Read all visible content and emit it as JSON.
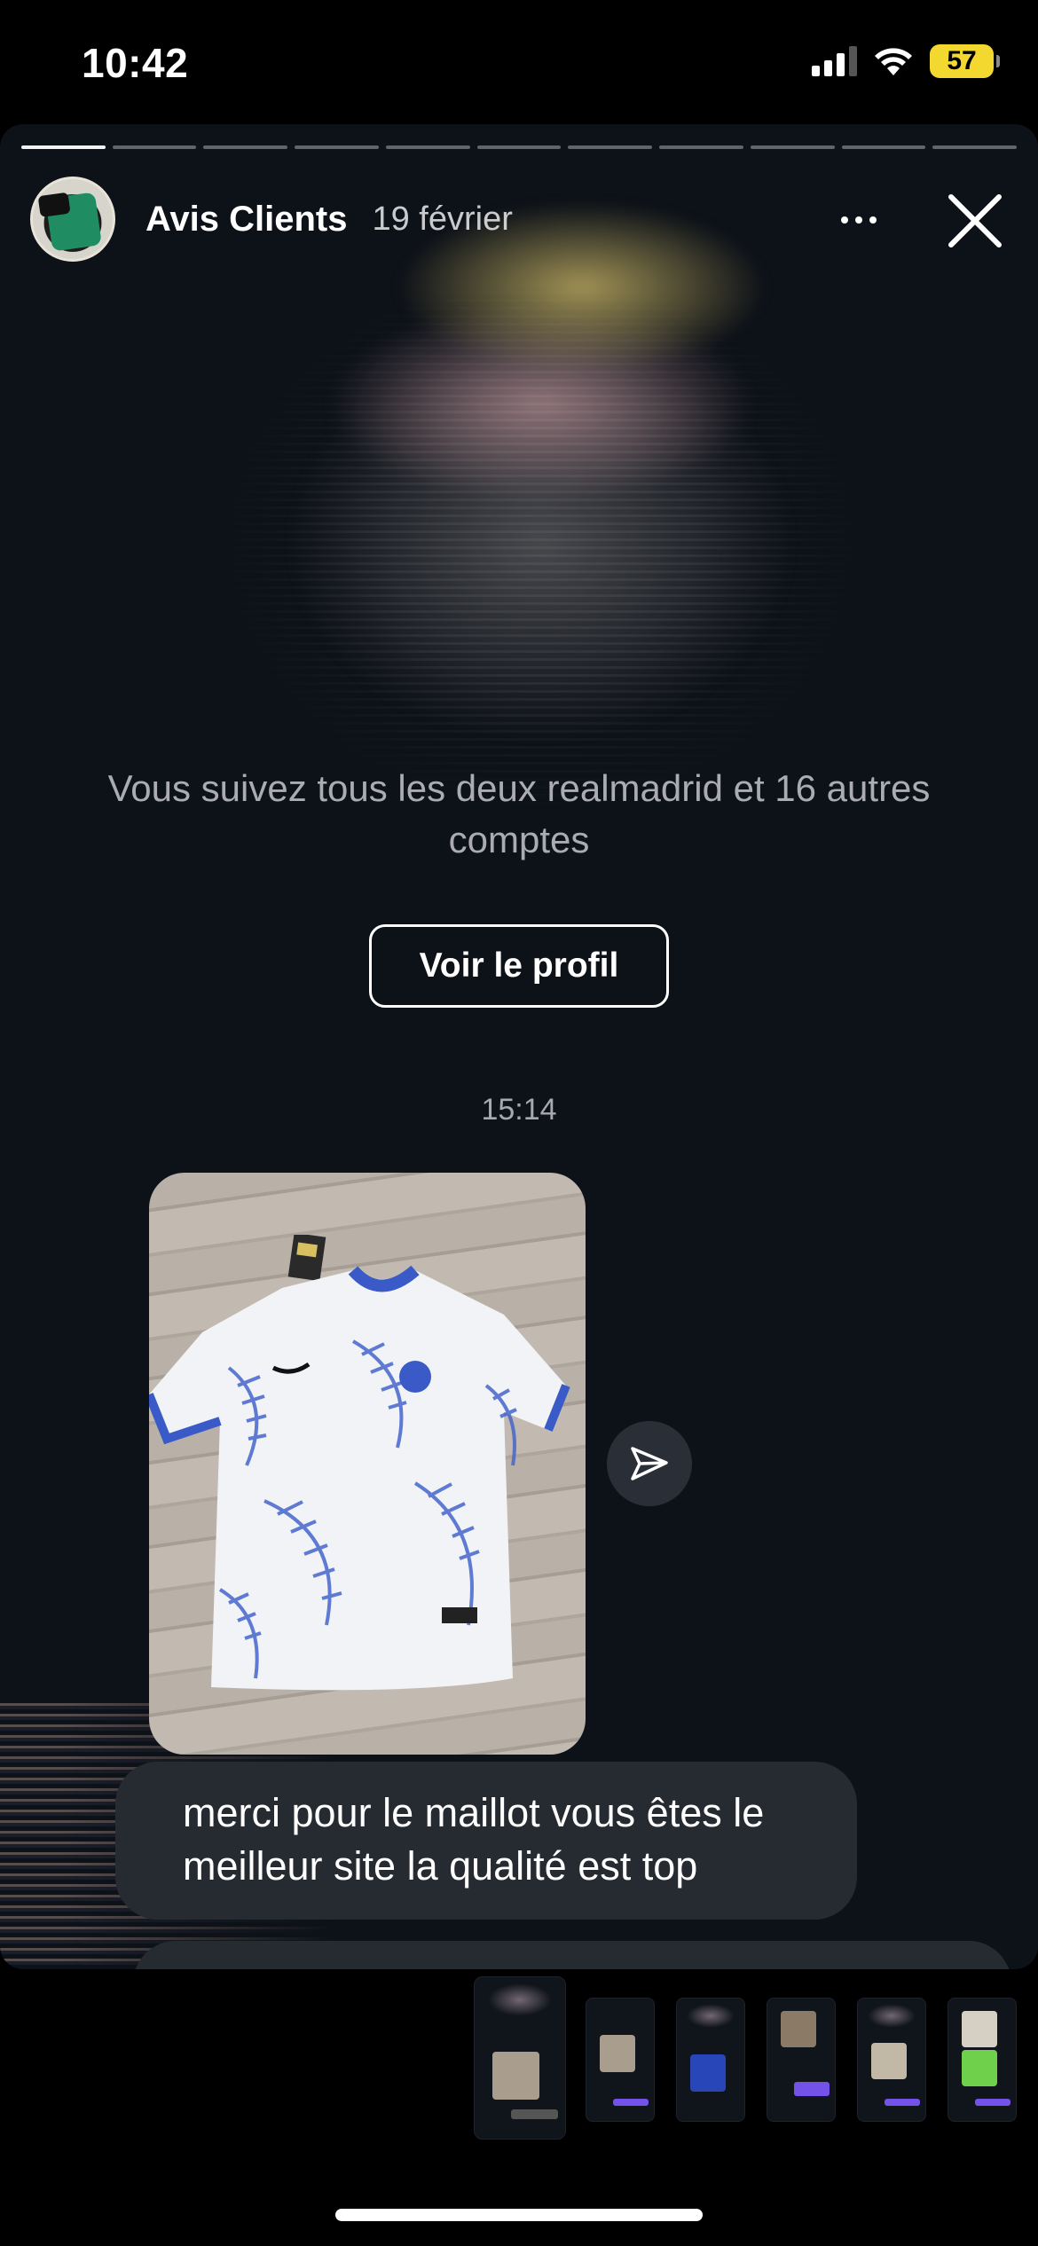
{
  "status_bar": {
    "time": "10:42",
    "battery": "57",
    "battery_color": "#f2d82f"
  },
  "story": {
    "account_name": "Avis Clients",
    "date": "19 février",
    "progress_segments": 11,
    "active_segment": 1,
    "follow_text": "Vous suivez tous les deux realmadrid et 16 autres comptes",
    "profile_button": "Voir le profil",
    "message_time": "15:14",
    "message_text": "merci pour le maillot vous êtes le meilleur site la qualité est top",
    "icons": {
      "more": "more-dots-icon",
      "close": "close-icon",
      "share": "send-icon"
    }
  },
  "thumbnails": {
    "count": 6,
    "current_index": 0
  },
  "colors": {
    "background": "#0d1118",
    "bubble": "#262a31",
    "accent_message": "#7252e8"
  }
}
